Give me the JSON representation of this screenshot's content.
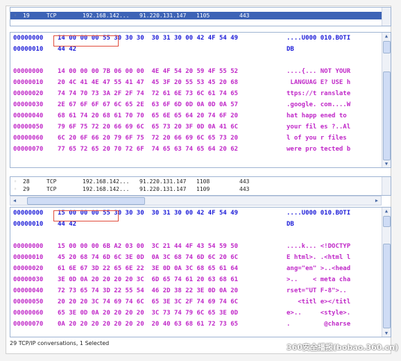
{
  "top_list": {
    "rows": [
      {
        "num": "19",
        "proto": "TCP",
        "src": "192.168.142...",
        "dst": "91.220.131.147",
        "port": "1105",
        "size": "443",
        "selected": true
      }
    ]
  },
  "hex1": {
    "lines": [
      {
        "off": "00000000",
        "bytes": "14 00 00 00 55 30 30 30  30 31 30 00 42 4F 54 49",
        "ascii": "....U000 010.BOTI",
        "color": "blue"
      },
      {
        "off": "00000010",
        "bytes": "44 42",
        "ascii": "DB",
        "color": "blue"
      },
      {
        "off": "",
        "bytes": "",
        "ascii": "",
        "color": "blue"
      },
      {
        "off": "00000000",
        "bytes": "14 00 00 00 7B 06 00 00  4E 4F 54 20 59 4F 55 52",
        "ascii": "....{... NOT YOUR",
        "color": "mag"
      },
      {
        "off": "00000010",
        "bytes": "20 4C 41 4E 47 55 41 47  45 3F 20 55 53 45 20 68",
        "ascii": " LANGUAG E? USE h",
        "color": "mag"
      },
      {
        "off": "00000020",
        "bytes": "74 74 70 73 3A 2F 2F 74  72 61 6E 73 6C 61 74 65",
        "ascii": "ttps://t ranslate",
        "color": "mag"
      },
      {
        "off": "00000030",
        "bytes": "2E 67 6F 6F 67 6C 65 2E  63 6F 6D 0D 0A 0D 0A 57",
        "ascii": ".google. com....W",
        "color": "mag"
      },
      {
        "off": "00000040",
        "bytes": "68 61 74 20 68 61 70 70  65 6E 65 64 20 74 6F 20",
        "ascii": "hat happ ened to",
        "color": "mag"
      },
      {
        "off": "00000050",
        "bytes": "79 6F 75 72 20 66 69 6C  65 73 20 3F 0D 0A 41 6C",
        "ascii": "your fil es ?..Al",
        "color": "mag"
      },
      {
        "off": "00000060",
        "bytes": "6C 20 6F 66 20 79 6F 75  72 20 66 69 6C 65 73 20",
        "ascii": "l of you r files",
        "color": "mag"
      },
      {
        "off": "00000070",
        "bytes": "77 65 72 65 20 70 72 6F  74 65 63 74 65 64 20 62",
        "ascii": "were pro tected b",
        "color": "mag"
      }
    ]
  },
  "bottom_list": {
    "rows": [
      {
        "num": "28",
        "proto": "TCP",
        "src": "192.168.142...",
        "dst": "91.220.131.147",
        "port": "1108",
        "size": "443",
        "selected": false
      },
      {
        "num": "29",
        "proto": "TCP",
        "src": "192.168.142...",
        "dst": "91.220.131.147",
        "port": "1109",
        "size": "443",
        "selected": false
      }
    ]
  },
  "hex2": {
    "lines": [
      {
        "off": "00000000",
        "bytes": "15 00 00 00 55 30 30 30  30 31 30 00 42 4F 54 49",
        "ascii": "....U000 010.BOTI",
        "color": "blue"
      },
      {
        "off": "00000010",
        "bytes": "44 42",
        "ascii": "DB",
        "color": "blue"
      },
      {
        "off": "",
        "bytes": "",
        "ascii": "",
        "color": "blue"
      },
      {
        "off": "00000000",
        "bytes": "15 00 00 00 6B A2 03 00  3C 21 44 4F 43 54 59 50",
        "ascii": "....k... <!DOCTYP",
        "color": "mag"
      },
      {
        "off": "00000010",
        "bytes": "45 20 68 74 6D 6C 3E 0D  0A 3C 68 74 6D 6C 20 6C",
        "ascii": "E html>. .<html l",
        "color": "mag"
      },
      {
        "off": "00000020",
        "bytes": "61 6E 67 3D 22 65 6E 22  3E 0D 0A 3C 68 65 61 64",
        "ascii": "ang=\"en\" >..<head",
        "color": "mag"
      },
      {
        "off": "00000030",
        "bytes": "3E 0D 0A 20 20 20 20 3C  6D 65 74 61 20 63 68 61",
        "ascii": ">..    < meta cha",
        "color": "mag"
      },
      {
        "off": "00000040",
        "bytes": "72 73 65 74 3D 22 55 54  46 2D 38 22 3E 0D 0A 20",
        "ascii": "rset=\"UT F-8\">..",
        "color": "mag"
      },
      {
        "off": "00000050",
        "bytes": "20 20 20 3C 74 69 74 6C  65 3E 3C 2F 74 69 74 6C",
        "ascii": "   <titl e></titl",
        "color": "mag"
      },
      {
        "off": "00000060",
        "bytes": "65 3E 0D 0A 20 20 20 20  3C 73 74 79 6C 65 3E 0D",
        "ascii": "e>..     <style>.",
        "color": "mag"
      },
      {
        "off": "00000070",
        "bytes": "0A 20 20 20 20 20 20 20  20 40 63 68 61 72 73 65",
        "ascii": ".         @charse",
        "color": "mag"
      }
    ]
  },
  "status": {
    "text": "29 TCP/IP conversations, 1 Selected"
  },
  "watermark": {
    "text": "360安全播报(bobao.360.cn)"
  },
  "colors": {
    "selection": "#3d63b6",
    "hex_blue": "#1c1cd8",
    "hex_magenta": "#c028c8",
    "highlight_box": "#e04a3a"
  }
}
